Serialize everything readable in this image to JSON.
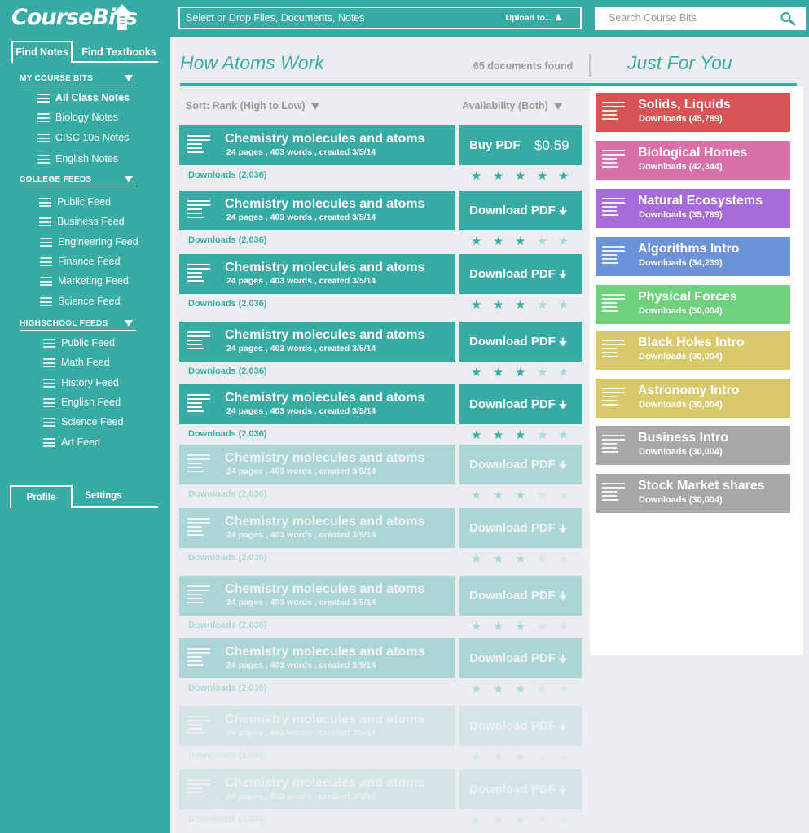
{
  "brand": {
    "logo_text": "CourseBits"
  },
  "sidebar": {
    "tabs": [
      "Find Notes",
      "Find Textbooks"
    ],
    "sections": [
      {
        "title": "MY COURSE BITS",
        "items": [
          "All Class Notes",
          "Biology Notes",
          "CISC 105 Notes",
          "English Notes"
        ]
      },
      {
        "title": "COLLEGE FEEDS",
        "items": [
          "Public Feed",
          "Business Feed",
          "Engineering Feed",
          "Finance Feed",
          "Marketing Feed",
          "Science Feed"
        ]
      },
      {
        "title": "HIGHSCHOOL FEEDS",
        "items": [
          "Public Feed",
          "Math Feed",
          "History Feed",
          "English Feed",
          "Science Feed",
          "Art Feed"
        ]
      }
    ],
    "bottom_tabs": [
      "Profile",
      "Settings"
    ]
  },
  "topbar": {
    "upload_label": "Select or Drop Files, Documents, Notes",
    "upload_button": "Upload to...",
    "search_placeholder": "Search Course Bits"
  },
  "main": {
    "title": "How Atoms Work",
    "doc_count": "65 documents found",
    "sort_label": "Sort: Rank (High to Low)",
    "availability_label": "Availability (Both)",
    "documents": [
      {
        "title": "Chemistry molecules and atoms",
        "meta": "24 pages , 403 words , created 3/5/14",
        "downloads": "Downloads  (2,036)",
        "action": "Buy PDF",
        "price": "$0.59",
        "rating": 5,
        "opacity": 1
      },
      {
        "title": "Chemistry molecules and atoms",
        "meta": "24 pages , 403 words , created 3/5/14",
        "downloads": "Downloads  (2,036)",
        "action": "Download PDF",
        "price": "",
        "rating": 3,
        "opacity": 1
      },
      {
        "title": "Chemistry molecules and atoms",
        "meta": "24 pages , 403 words , created 3/5/14",
        "downloads": "Downloads  (2,036)",
        "action": "Download PDF",
        "price": "",
        "rating": 3,
        "opacity": 1
      },
      {
        "title": "Chemistry molecules and atoms",
        "meta": "24 pages , 403 words , created 3/5/14",
        "downloads": "Downloads  (2,036)",
        "action": "Download PDF",
        "price": "",
        "rating": 3,
        "opacity": 1
      },
      {
        "title": "Chemistry molecules and atoms",
        "meta": "24 pages , 403 words , created 3/5/14",
        "downloads": "Downloads  (2,036)",
        "action": "Download PDF",
        "price": "",
        "rating": 3,
        "opacity": 1
      },
      {
        "title": "Chemistry molecules and atoms",
        "meta": "24 pages , 403 words , created 3/5/14",
        "downloads": "Downloads  (2,036)",
        "action": "Download PDF",
        "price": "",
        "rating": 3,
        "opacity": 0.35
      },
      {
        "title": "Chemistry molecules and atoms",
        "meta": "24 pages , 403 words , created 3/5/14",
        "downloads": "Downloads  (2,036)",
        "action": "Download PDF",
        "price": "",
        "rating": 3,
        "opacity": 0.35
      },
      {
        "title": "Chemistry molecules and atoms",
        "meta": "24 pages , 403 words , created 3/5/14",
        "downloads": "Downloads  (2,036)",
        "action": "Download PDF",
        "price": "",
        "rating": 3,
        "opacity": 0.35
      },
      {
        "title": "Chemistry molecules and atoms",
        "meta": "24 pages , 403 words , created 3/5/14",
        "downloads": "Downloads  (2,036)",
        "action": "Download PDF",
        "price": "",
        "rating": 3,
        "opacity": 0.35
      },
      {
        "title": "Chemistry molecules and atoms",
        "meta": "24 pages , 403 words , created 3/5/14",
        "downloads": "Downloads  (2,036)",
        "action": "Download PDF",
        "price": "",
        "rating": 3,
        "opacity": 0.12
      },
      {
        "title": "Chemistry molecules and atoms",
        "meta": "24 pages , 403 words , created 3/5/14",
        "downloads": "Downloads  (2,036)",
        "action": "Download PDF",
        "price": "",
        "rating": 3,
        "opacity": 0.12
      }
    ]
  },
  "just_for_you": {
    "title": "Just For You",
    "items": [
      {
        "title": "Solids,  Liquids",
        "downloads": "Downloads (45,789)",
        "color": "#d85454"
      },
      {
        "title": "Biological Homes",
        "downloads": "Downloads (42,344)",
        "color": "#d970a8"
      },
      {
        "title": "Natural Ecosystems",
        "downloads": "Downloads (35,789)",
        "color": "#a86cd8"
      },
      {
        "title": "Algorithms Intro",
        "downloads": "Downloads (34,239)",
        "color": "#6c93d8"
      },
      {
        "title": "Physical Forces",
        "downloads": "Downloads (30,004)",
        "color": "#70d27c"
      },
      {
        "title": "Black Holes Intro",
        "downloads": "Downloads (30,004)",
        "color": "#d8c96a"
      },
      {
        "title": "Astronomy Intro",
        "downloads": "Downloads (30,004)",
        "color": "#d8c96a"
      },
      {
        "title": "Business Intro",
        "downloads": "Downloads (30,004)",
        "color": "#a8a8a8"
      },
      {
        "title": "Stock Market shares",
        "downloads": "Downloads (30,004)",
        "color": "#a8a8a8"
      }
    ]
  },
  "colors": {
    "accent": "#38aca4",
    "background": "#ecedf1"
  }
}
